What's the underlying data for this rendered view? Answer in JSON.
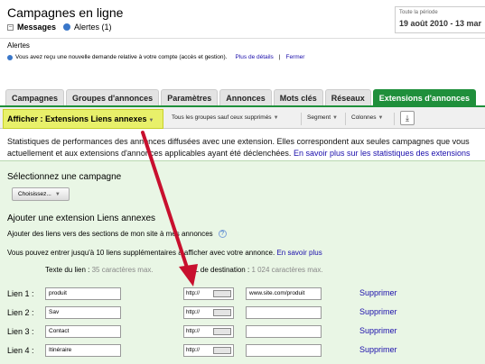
{
  "header": {
    "title": "Campagnes en ligne",
    "messages_label": "Messages",
    "alerts_label": "Alertes (1)"
  },
  "date_range": {
    "label": "Toute la période",
    "value": "19 août 2010 - 13 mar"
  },
  "alerts": {
    "title": "Alertes",
    "message": "Vous avez reçu une nouvelle demande relative à votre compte (accès et gestion).",
    "details_link": "Plus de détails",
    "separator": "|",
    "close_link": "Fermer"
  },
  "tabs": [
    {
      "label": "Campagnes"
    },
    {
      "label": "Groupes d'annonces"
    },
    {
      "label": "Paramètres"
    },
    {
      "label": "Annonces"
    },
    {
      "label": "Mots clés"
    },
    {
      "label": "Réseaux"
    },
    {
      "label": "Extensions d'annonces"
    }
  ],
  "toolbar": {
    "view_label": "Afficher : Extensions Liens annexes",
    "filter_label": "Tous les groupes sauf ceux supprimés",
    "segment_label": "Segment",
    "columns_label": "Colonnes"
  },
  "description": {
    "line1": "Statistiques de performances des annonces diffusées avec une extension. Elles correspondent aux seules campagnes que vous",
    "line2": "actuellement et aux extensions d'annonces applicables ayant été déclenchées.",
    "link": "En savoir plus sur les statistiques des extensions"
  },
  "campaign_select": {
    "title": "Sélectionnez une campagne",
    "button_label": "Choisissez..."
  },
  "sitelinks": {
    "title": "Ajouter une extension Liens annexes",
    "checkbox_label": "Ajouter des liens vers des sections de mon site à mes annonces",
    "hint": "Vous pouvez entrer jusqu'à 10 liens supplémentaires à afficher avec votre annonce.",
    "hint_link": "En savoir plus",
    "col_text_label": "Texte du lien :",
    "col_text_limit": "35 caractères max.",
    "col_url_label": "URL de destination :",
    "col_url_limit": "1 024 caractères max.",
    "protocol": "http://",
    "delete_label": "Supprimer",
    "rows": [
      {
        "label": "Lien 1 :",
        "text": "produit",
        "url": "www.site.com/produit"
      },
      {
        "label": "Lien 2 :",
        "text": "Sav",
        "url": ""
      },
      {
        "label": "Lien 3 :",
        "text": "Contact",
        "url": ""
      },
      {
        "label": "Lien 4 :",
        "text": "Itinéraire",
        "url": ""
      }
    ]
  },
  "colors": {
    "active_tab": "#1f8f3b",
    "highlight": "#e8f06a",
    "panel_bg": "#e9f6e5",
    "arrow": "#c8102e",
    "link": "#1a0dab"
  }
}
